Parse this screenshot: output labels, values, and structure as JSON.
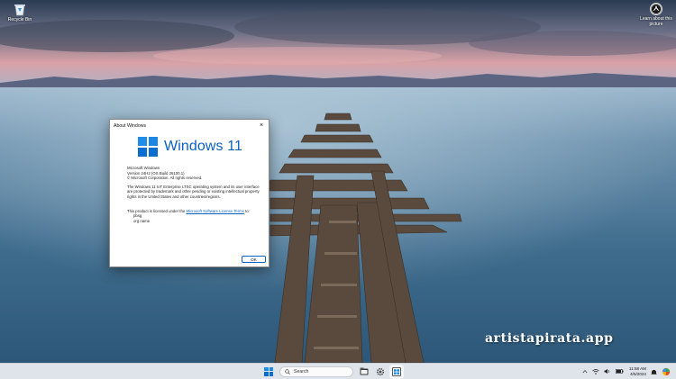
{
  "desktop": {
    "icons": [
      {
        "label": "Recycle Bin",
        "icon": "recycle-bin-icon"
      },
      {
        "label": "Learn about this picture",
        "icon": "learn-about-picture-icon"
      }
    ]
  },
  "dialog": {
    "title": "About Windows",
    "close_glyph": "×",
    "brand": "Windows 11",
    "product": "Microsoft Windows",
    "version": "Version 24H2 (OS Build 26100.1)",
    "copyright": "© Microsoft Corporation. All rights reserved.",
    "legal": "The Windows 11 IoT Enterprise LTSC operating system and its user interface are protected by trademark and other pending or existing intellectual property rights in the United States and other countries/regions.",
    "license_prefix": "This product is licensed under the",
    "license_link": "Microsoft Software License Terms",
    "license_suffix": "to:",
    "licensed_user": "pbsg",
    "licensed_org": "org name",
    "ok_label": "OK",
    "colors": {
      "accent": "#0b62c4"
    }
  },
  "watermark": "artistapirata.app",
  "taskbar": {
    "search_placeholder": "Search",
    "apps": [
      {
        "name": "file-explorer"
      },
      {
        "name": "settings"
      },
      {
        "name": "about-windows"
      }
    ],
    "clock": {
      "time": "11:58 AM",
      "date": "4/5/2024"
    },
    "colors": {
      "background": "#dfe3ea"
    }
  }
}
